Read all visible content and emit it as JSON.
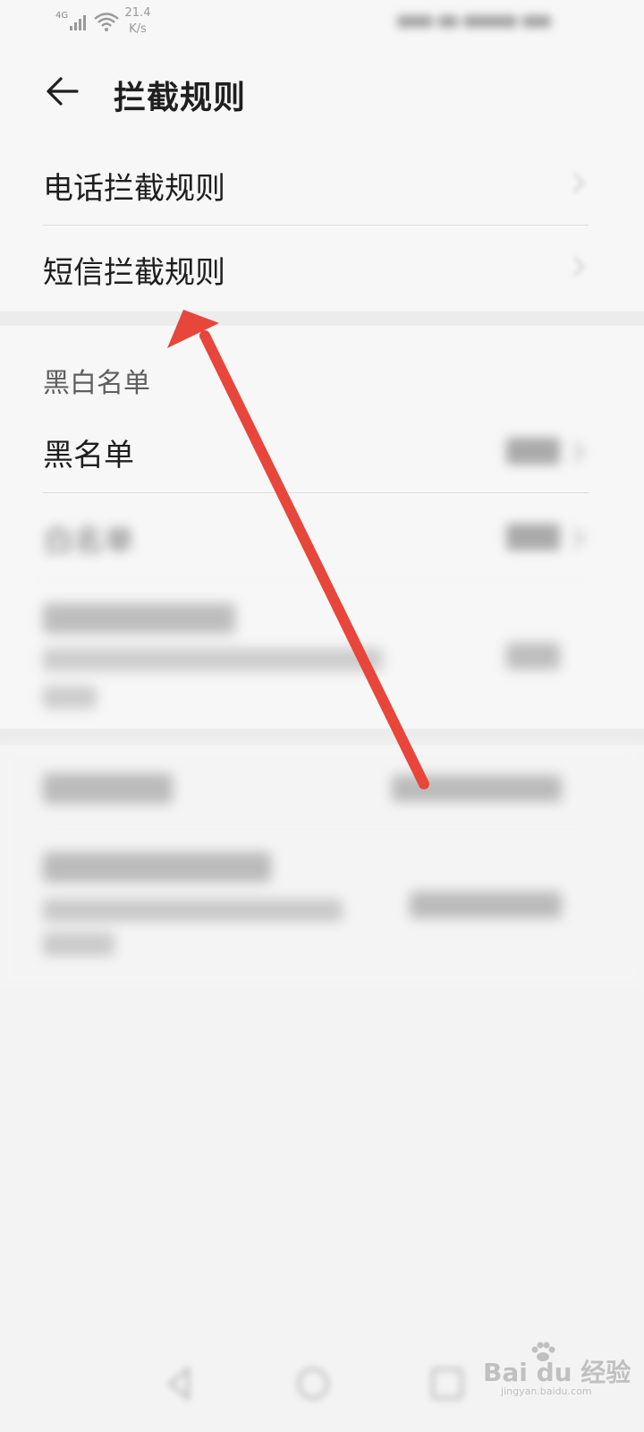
{
  "status_bar": {
    "network": "4G",
    "speed_value": "21.4",
    "speed_unit": "K/s"
  },
  "header": {
    "title": "拦截规则"
  },
  "rules": {
    "items": [
      {
        "label": "电话拦截规则"
      },
      {
        "label": "短信拦截规则"
      }
    ]
  },
  "black_white": {
    "section_title": "黑白名单",
    "items": [
      {
        "label": "黑名单"
      },
      {
        "label": "白名单"
      }
    ]
  },
  "watermark": {
    "brand": "Bai du 经验",
    "url": "jingyan.baidu.com"
  },
  "colors": {
    "arrow": "#e8463b",
    "background": "#f7f7f7",
    "divider": "#dcdcdc"
  }
}
